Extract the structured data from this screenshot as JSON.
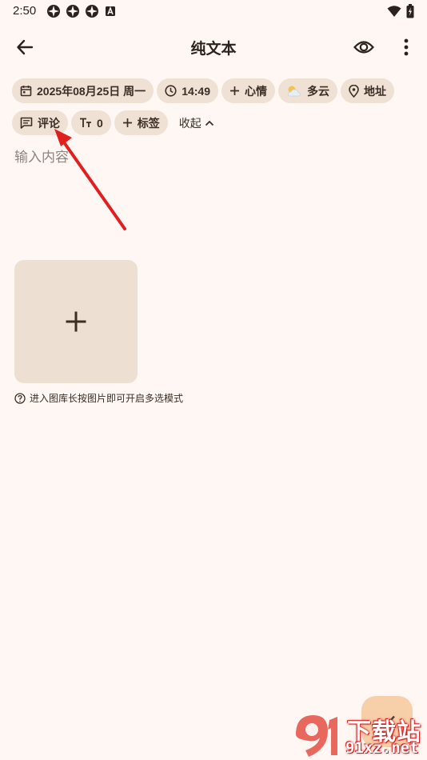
{
  "status_bar": {
    "time": "2:50",
    "icons": [
      "app-notification-icon",
      "app-notification-icon",
      "app-notification-icon",
      "font-notification-icon"
    ],
    "right_icons": [
      "wifi-icon",
      "battery-icon"
    ]
  },
  "toolbar": {
    "title": "纯文本",
    "back_icon": "back-arrow-icon",
    "preview_icon": "eye-icon",
    "more_icon": "more-vert-icon"
  },
  "chips_row1": [
    {
      "icon": "calendar-icon",
      "label": "2025年08月25日 周一"
    },
    {
      "icon": "clock-icon",
      "label": "14:49"
    },
    {
      "icon": "plus-icon",
      "label": "心情"
    },
    {
      "icon": "cloudy-icon",
      "label": "多云"
    },
    {
      "icon": "location-icon",
      "label": "地址"
    }
  ],
  "chips_row2": [
    {
      "icon": "comment-icon",
      "label": "评论"
    },
    {
      "icon": "text-size-icon",
      "label": "0"
    },
    {
      "icon": "plus-icon",
      "label": "标签"
    }
  ],
  "collapse": {
    "label": "收起",
    "icon": "chevron-up-icon"
  },
  "editor": {
    "placeholder": "输入内容"
  },
  "gallery": {
    "add_icon": "plus-icon",
    "hint": "进入图库长按图片即可开启多选模式",
    "hint_icon": "help-circle-icon"
  },
  "fab": {
    "icon": "check-icon"
  },
  "watermark": {
    "top": "下载站",
    "bottom": "91xz.net"
  },
  "colors": {
    "background": "#fff7f3",
    "chip": "#efe1d4",
    "tile": "#ede0d2",
    "annotation": "#e0201e",
    "fab": "#f6c89a"
  }
}
